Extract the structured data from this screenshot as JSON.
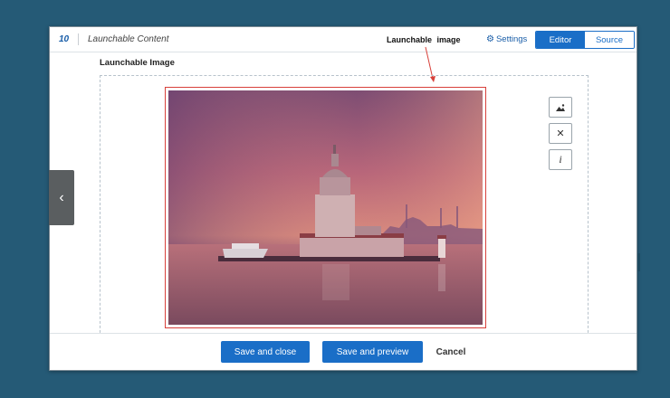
{
  "header": {
    "item_number": "10",
    "item_title": "Launchable Content",
    "annotation": "Launchable  image",
    "settings_label": "Settings",
    "tabs": [
      {
        "label": "Editor",
        "active": true
      },
      {
        "label": "Source",
        "active": false
      }
    ]
  },
  "section": {
    "label": "Launchable Image"
  },
  "toolbar": {
    "icons": [
      "image-icon",
      "close-icon",
      "info-icon"
    ],
    "info_glyph": "i",
    "close_glyph": "✕"
  },
  "sidebar_toggle": {
    "glyph": "‹"
  },
  "footer": {
    "save_close_label": "Save and close",
    "save_preview_label": "Save and preview",
    "cancel_label": "Cancel"
  },
  "colors": {
    "background": "#255a76",
    "accent": "#1a6ec7",
    "annotation_red": "#d8403a"
  }
}
